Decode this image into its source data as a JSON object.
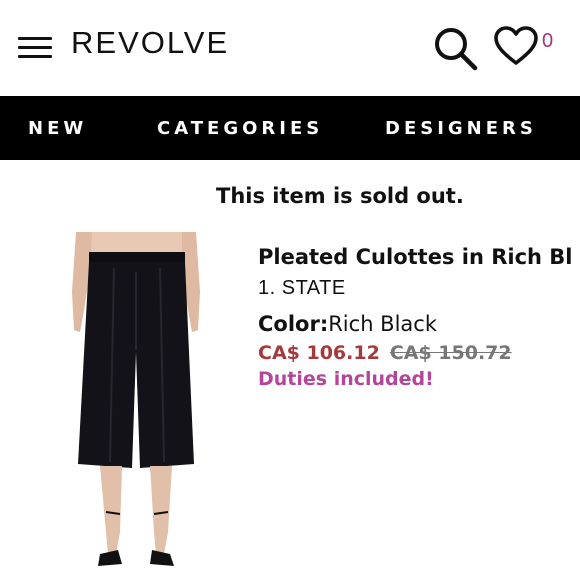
{
  "header": {
    "logo": "REVOLVE",
    "wishlist_count": "0"
  },
  "nav": {
    "items": [
      "NEW",
      "CATEGORIES",
      "DESIGNERS"
    ]
  },
  "notice": "This item is sold out.",
  "product": {
    "title": "Pleated Culottes in Rich Bl",
    "brand": "1. STATE",
    "color_label": "Color:",
    "color_value": "Rich Black",
    "sale_price": "CA$ 106.12",
    "original_price": "CA$ 150.72",
    "duties_note": "Duties included!"
  },
  "colors": {
    "brand_accent": "#a1347c",
    "sale_price": "#a53a3a",
    "duties": "#b3469b",
    "nav_background": "#000000"
  },
  "icons": {
    "menu": "hamburger-menu-icon",
    "search": "search-icon",
    "wishlist": "heart-icon"
  }
}
